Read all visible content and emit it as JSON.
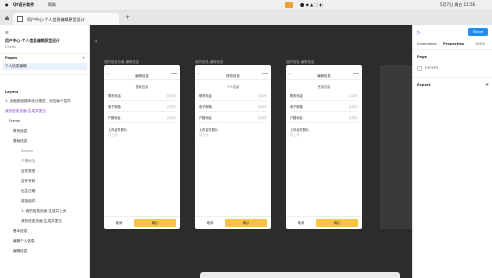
{
  "menubar": {
    "apple": "",
    "app_name": "Qt设计软件",
    "menu_item": "帮助",
    "date_time": "5月7日 周五 11:56"
  },
  "tabs": [
    {
      "label": "用户中心-个人信息编辑原型设计"
    }
  ],
  "left_panel": {
    "file_title": "用户中心-个人信息编辑原型设计",
    "file_subtitle": "Drafts",
    "pages_label": "Pages",
    "current_page": "个人信息编辑",
    "layers_label": "Layers",
    "layers": [
      "1. 页面按钮顺序设计规范，对应每个控件",
      "我的信息页面-生成并提交",
      "Frame",
      "联系信息",
      "基础信息",
      "Search",
      "户籍地址",
      "证件类型",
      "证件号码",
      "出生日期",
      "按钮组件",
      "1. 我的信息页面-生成并上传",
      "我的信息页面-生成并提交",
      "基本信息",
      "编辑个人信息",
      "编辑信息"
    ]
  },
  "frames": [
    {
      "label": "我的信息页面-编辑信息",
      "nav_title": "编辑信息",
      "section": "基础信息",
      "rows": [
        {
          "label": "联系电话",
          "hint": "请填写"
        },
        {
          "label": "电子邮箱",
          "hint": "请填写"
        },
        {
          "label": "户籍地址",
          "hint": "请填写"
        }
      ],
      "extra_label": "上传证件照片",
      "extra_hint": "请上传",
      "cancel": "取消",
      "submit": "确认"
    },
    {
      "label": "我的信息-编辑信息",
      "nav_title": "修改信息",
      "section": "个人信息",
      "rows": [
        {
          "label": "联系电话",
          "hint": "请填写"
        },
        {
          "label": "电子邮箱",
          "hint": "请填写"
        },
        {
          "label": "户籍地址",
          "hint": "请填写"
        }
      ],
      "extra_label": "上传证件照片",
      "extra_hint": "请上传",
      "cancel": "取消",
      "submit": "确认"
    },
    {
      "label": "我的信息-编辑信息",
      "nav_title": "编辑信息",
      "section": "完善信息",
      "rows": [
        {
          "label": "联系电话",
          "hint": "请填写"
        },
        {
          "label": "电子邮箱",
          "hint": "请填写"
        },
        {
          "label": "户籍地址",
          "hint": "请填写"
        }
      ],
      "extra_label": "上传证件照片",
      "extra_hint": "请上传",
      "cancel": "取消",
      "submit": "确认"
    }
  ],
  "right_panel": {
    "tab_comments": "Comments",
    "tab_properties": "Properties",
    "share": "Share",
    "zoom": "100%",
    "section_page": "Page",
    "fill_value": "F5F5F5",
    "section_export": "Export",
    "add": "+"
  },
  "colors": {
    "accent": "#1f8ef1",
    "submit_btn": "#f6c443",
    "canvas": "#2c2c2c"
  }
}
